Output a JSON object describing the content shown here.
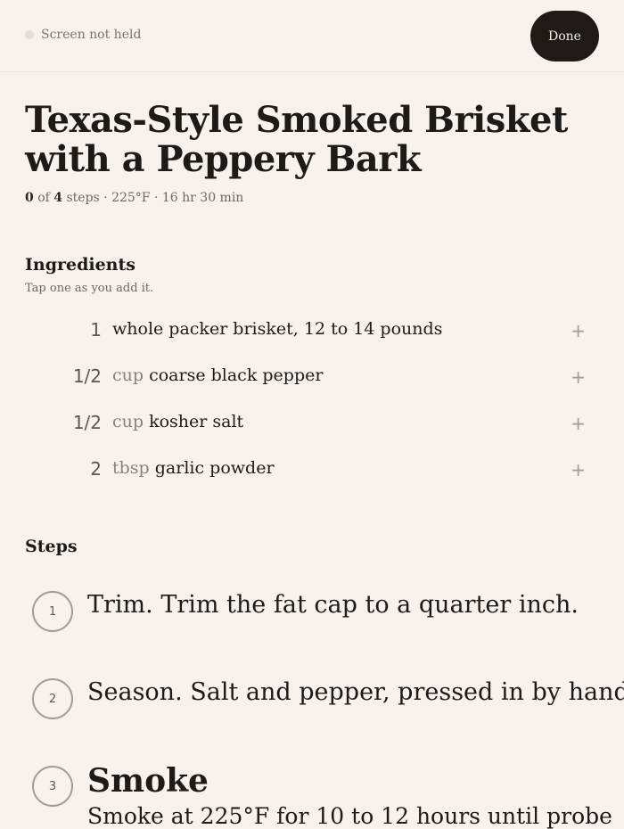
{
  "header": {
    "status_text": "Screen not held",
    "done_label": "Done"
  },
  "recipe": {
    "title": "Texas-Style Smoked Brisket with a Peppery Bark",
    "meta": {
      "completed": "0",
      "of_text": "of",
      "total": "4",
      "rest": "steps · 225°F · 16 hr 30 min"
    }
  },
  "ingredients": {
    "heading": "Ingredients",
    "subtitle": "Tap one as you add it.",
    "items": [
      {
        "qty": "1",
        "unit": "",
        "name": "whole packer brisket, 12 to 14 pounds"
      },
      {
        "qty": "1/2",
        "unit": "cup",
        "name": "coarse black pepper"
      },
      {
        "qty": "1/2",
        "unit": "cup",
        "name": "kosher salt"
      },
      {
        "qty": "2",
        "unit": "tbsp",
        "name": "garlic powder"
      }
    ],
    "add_symbol": "+"
  },
  "steps": {
    "heading": "Steps",
    "items": [
      {
        "number": "1",
        "text": "Trim. Trim the fat cap to a quarter inch."
      },
      {
        "number": "2",
        "text": "Season. Salt and pepper, pressed in by hand."
      },
      {
        "number": "3",
        "title": "Smoke",
        "text": "Smoke at 225°F for 10 to 12 hours until probe"
      }
    ]
  },
  "colors": {
    "background": "#f9f1ec",
    "button": "#1f1a18",
    "text": "#1d1a18",
    "muted": "#6f6761"
  }
}
